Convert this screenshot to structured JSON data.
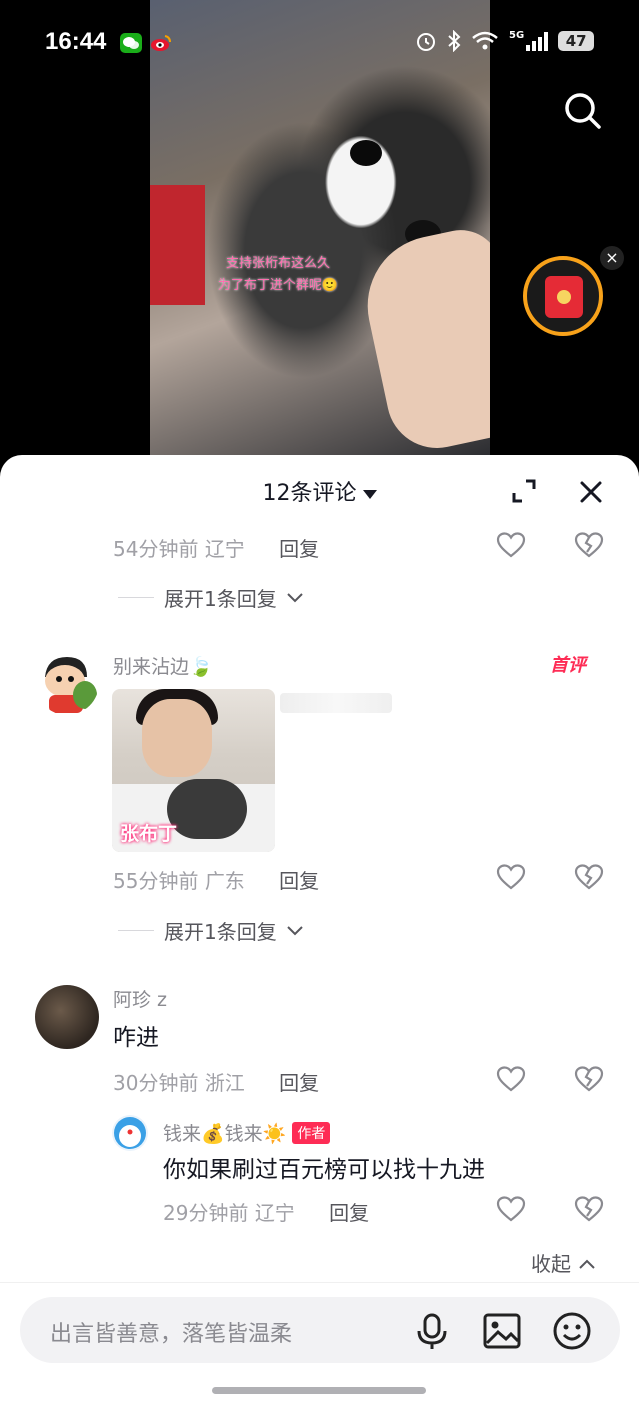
{
  "status_bar": {
    "time": "16:44",
    "network": "5G",
    "battery": "47",
    "icons": [
      "wechat-icon",
      "weibo-icon",
      "alarm-icon",
      "bluetooth-icon",
      "wifi-icon",
      "signal-icon"
    ]
  },
  "video": {
    "caption_line1": "支持张桁布这么久",
    "caption_line2": "为了布丁进个群呢🙂"
  },
  "comments_sheet": {
    "title": "12条评论",
    "top_meta": {
      "time": "54分钟前",
      "location": "辽宁",
      "reply": "回复"
    },
    "expand1": "展开1条回复",
    "comment1": {
      "name": "别来沾边🍃",
      "badge": "首评",
      "image_tag": "张布丁",
      "time": "55分钟前",
      "location": "广东",
      "reply": "回复"
    },
    "expand2": "展开1条回复",
    "comment2": {
      "name": "阿珍 z",
      "text": "咋进",
      "time": "30分钟前",
      "location": "浙江",
      "reply": "回复"
    },
    "reply1": {
      "name": "钱来💰钱来☀️",
      "author_badge": "作者",
      "text": "你如果刷过百元榜可以找十九进",
      "time": "29分钟前",
      "location": "辽宁",
      "reply": "回复"
    },
    "collapse": "收起"
  },
  "input": {
    "placeholder": "出言皆善意，落笔皆温柔"
  },
  "colors": {
    "accent": "#fe2c55",
    "meta_gray": "#a0a0a6",
    "text": "#161823"
  }
}
